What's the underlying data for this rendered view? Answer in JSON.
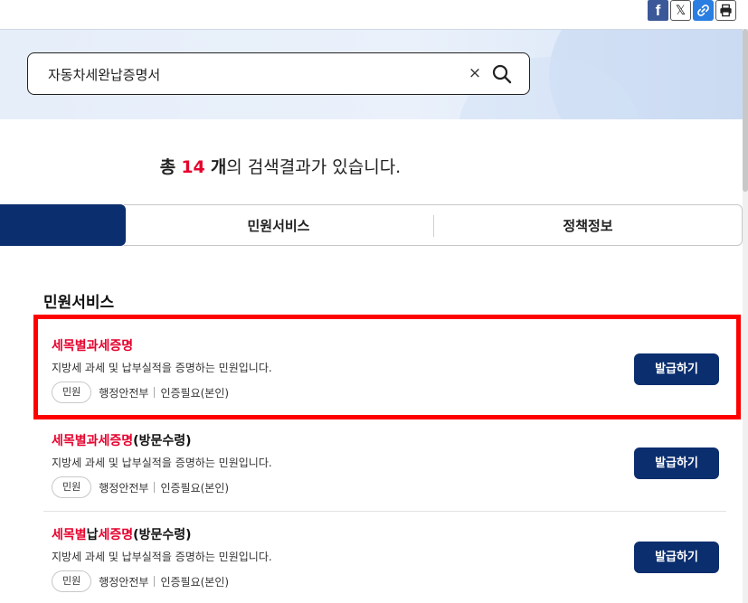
{
  "share": {
    "icons": [
      "facebook-icon",
      "x-icon",
      "link-icon",
      "print-icon"
    ],
    "facebook_letter": "f",
    "x_letter": "𝕏"
  },
  "search": {
    "value": "자동차세완납증명서",
    "placeholder": "",
    "clear_symbol": "×"
  },
  "result": {
    "prefix": "총",
    "count": "14",
    "unit": "개",
    "suffix": "의 검색결과가 있습니다."
  },
  "tabs": {
    "active_label": "",
    "items": [
      {
        "label": "민원서비스"
      },
      {
        "label": "정책정보"
      }
    ]
  },
  "section": {
    "title": "민원서비스"
  },
  "results": [
    {
      "title_parts": [
        {
          "text": "세목별과세증명",
          "highlight": true
        }
      ],
      "description": "지방세 과세 및 납부실적을 증명하는 민원입니다.",
      "badge": "민원",
      "org": "행정안전부",
      "auth": "인증필요(본인)",
      "button": "발급하기",
      "highlighted": true
    },
    {
      "title_parts": [
        {
          "text": "세목별과세증명",
          "highlight": true
        },
        {
          "text": "(방문수령)",
          "highlight": false
        }
      ],
      "description": "지방세 과세 및 납부실적을 증명하는 민원입니다.",
      "badge": "민원",
      "org": "행정안전부",
      "auth": "인증필요(본인)",
      "button": "발급하기",
      "highlighted": false
    },
    {
      "title_parts": [
        {
          "text": "세목별",
          "highlight": true
        },
        {
          "text": "납",
          "highlight": false
        },
        {
          "text": "세증명",
          "highlight": true
        },
        {
          "text": "(방문수령)",
          "highlight": false
        }
      ],
      "description": "지방세 과세 및 납부실적을 증명하는 민원입니다.",
      "badge": "민원",
      "org": "행정안전부",
      "auth": "인증필요(본인)",
      "button": "발급하기",
      "highlighted": false
    }
  ],
  "colors": {
    "brand_navy": "#0b2e6e",
    "highlight_red": "#e6002d",
    "annotation_red": "#ff0000"
  }
}
